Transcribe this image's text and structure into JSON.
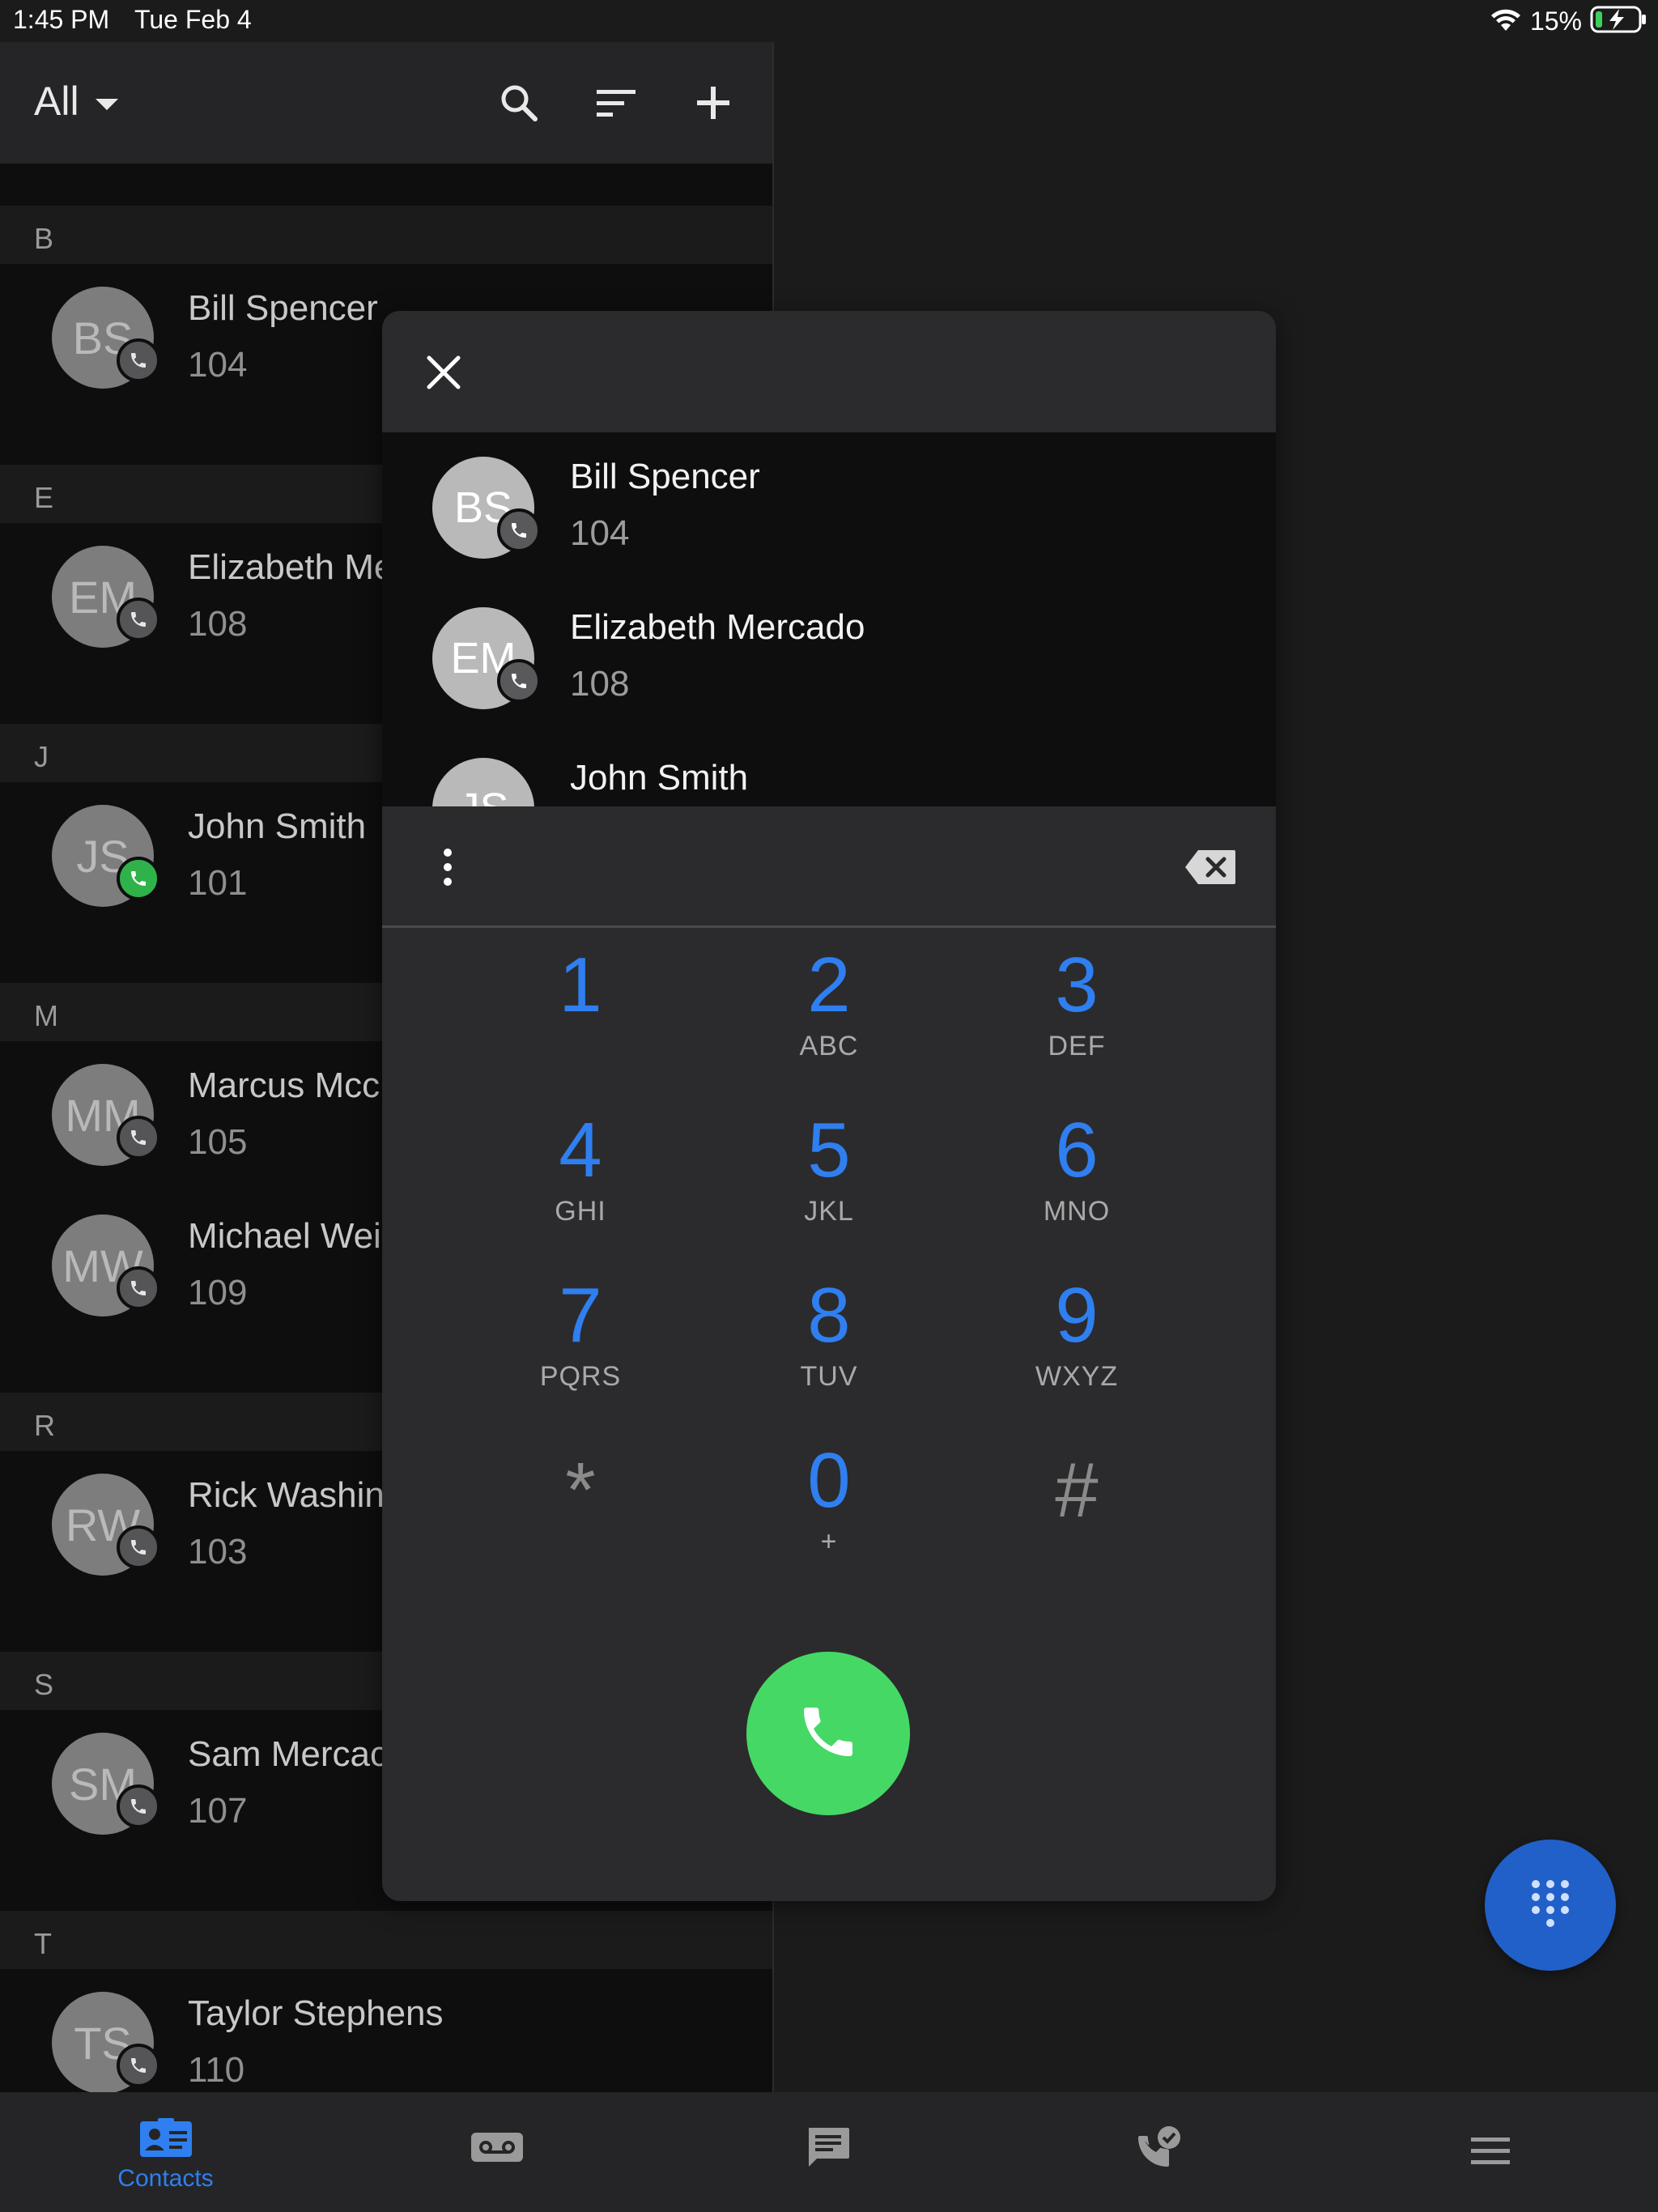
{
  "status_bar": {
    "time": "1:45 PM",
    "date": "Tue Feb 4",
    "battery": "15%"
  },
  "contacts_header": {
    "filter": "All"
  },
  "sections": [
    {
      "letter": "B",
      "contacts": [
        {
          "initials": "BS",
          "name": "Bill Spencer",
          "ext": "104",
          "status": "idle"
        }
      ]
    },
    {
      "letter": "E",
      "contacts": [
        {
          "initials": "EM",
          "name": "Elizabeth Mercado",
          "ext": "108",
          "status": "idle"
        }
      ]
    },
    {
      "letter": "J",
      "contacts": [
        {
          "initials": "JS",
          "name": "John Smith",
          "ext": "101",
          "status": "available"
        }
      ]
    },
    {
      "letter": "M",
      "contacts": [
        {
          "initials": "MM",
          "name": "Marcus Mcc",
          "ext": "105",
          "status": "idle"
        },
        {
          "initials": "MW",
          "name": "Michael Wei",
          "ext": "109",
          "status": "idle"
        }
      ]
    },
    {
      "letter": "R",
      "contacts": [
        {
          "initials": "RW",
          "name": "Rick Washin",
          "ext": "103",
          "status": "idle"
        }
      ]
    },
    {
      "letter": "S",
      "contacts": [
        {
          "initials": "SM",
          "name": "Sam Mercac",
          "ext": "107",
          "status": "idle"
        }
      ]
    },
    {
      "letter": "T",
      "contacts": [
        {
          "initials": "TS",
          "name": "Taylor Stephens",
          "ext": "110",
          "status": "idle"
        }
      ]
    }
  ],
  "dialer": {
    "results": [
      {
        "initials": "BS",
        "name": "Bill Spencer",
        "ext": "104"
      },
      {
        "initials": "EM",
        "name": "Elizabeth Mercado",
        "ext": "108"
      },
      {
        "initials": "JS",
        "name": "John Smith",
        "ext": ""
      }
    ],
    "input_value": "",
    "keys": [
      {
        "digit": "1",
        "letters": ""
      },
      {
        "digit": "2",
        "letters": "ABC"
      },
      {
        "digit": "3",
        "letters": "DEF"
      },
      {
        "digit": "4",
        "letters": "GHI"
      },
      {
        "digit": "5",
        "letters": "JKL"
      },
      {
        "digit": "6",
        "letters": "MNO"
      },
      {
        "digit": "7",
        "letters": "PQRS"
      },
      {
        "digit": "8",
        "letters": "TUV"
      },
      {
        "digit": "9",
        "letters": "WXYZ"
      },
      {
        "digit": "*",
        "letters": ""
      },
      {
        "digit": "0",
        "letters": "+"
      },
      {
        "digit": "#",
        "letters": ""
      }
    ]
  },
  "tabs": [
    {
      "label": "Contacts",
      "icon": "contacts-icon",
      "active": true
    },
    {
      "label": "",
      "icon": "voicemail-icon",
      "active": false
    },
    {
      "label": "",
      "icon": "chat-icon",
      "active": false
    },
    {
      "label": "",
      "icon": "call-history-icon",
      "active": false
    },
    {
      "label": "",
      "icon": "menu-icon",
      "active": false
    }
  ],
  "colors": {
    "accent": "#2f7ff0",
    "call_green": "#46d865",
    "available_green": "#2fb24a",
    "fab_blue": "#2160c8"
  }
}
